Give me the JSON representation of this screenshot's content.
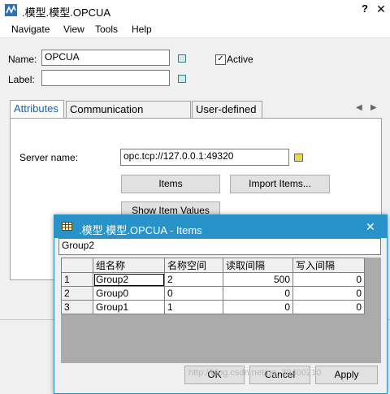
{
  "window": {
    "title": ".模型.模型.OPCUA",
    "help_glyph": "?",
    "close_glyph": "✕"
  },
  "menu": [
    "Navigate",
    "View",
    "Tools",
    "Help"
  ],
  "form": {
    "name_label": "Name:",
    "name_value": "OPCUA",
    "label_label": "Label:",
    "label_value": "",
    "active_label": "Active",
    "active_checked": true
  },
  "tabs": [
    "Attributes",
    "Communication Statistics",
    "User-defined"
  ],
  "attributes": {
    "server_label": "Server name:",
    "server_value": "opc.tcp://127.0.0.1:49320",
    "items_button": "Items",
    "import_button": "Import Items...",
    "show_button": "Show Item Values"
  },
  "dialog": {
    "title": ".模型.模型.OPCUA - Items",
    "close_glyph": "✕",
    "group_value": "Group2",
    "columns": [
      "",
      "组名称",
      "名称空间",
      "读取间隔",
      "写入间隔"
    ],
    "rows": [
      {
        "index": "1",
        "name": "Group2",
        "namespace": "2",
        "read_interval": "500",
        "write_interval": "0"
      },
      {
        "index": "2",
        "name": "Group0",
        "namespace": "0",
        "read_interval": "0",
        "write_interval": "0"
      },
      {
        "index": "3",
        "name": "Group1",
        "namespace": "1",
        "read_interval": "0",
        "write_interval": "0"
      }
    ],
    "ok_button": "OK",
    "cancel_button": "Cancel",
    "apply_button": "Apply"
  },
  "watermark": "http://blog.csdn.net/qq_30400210"
}
